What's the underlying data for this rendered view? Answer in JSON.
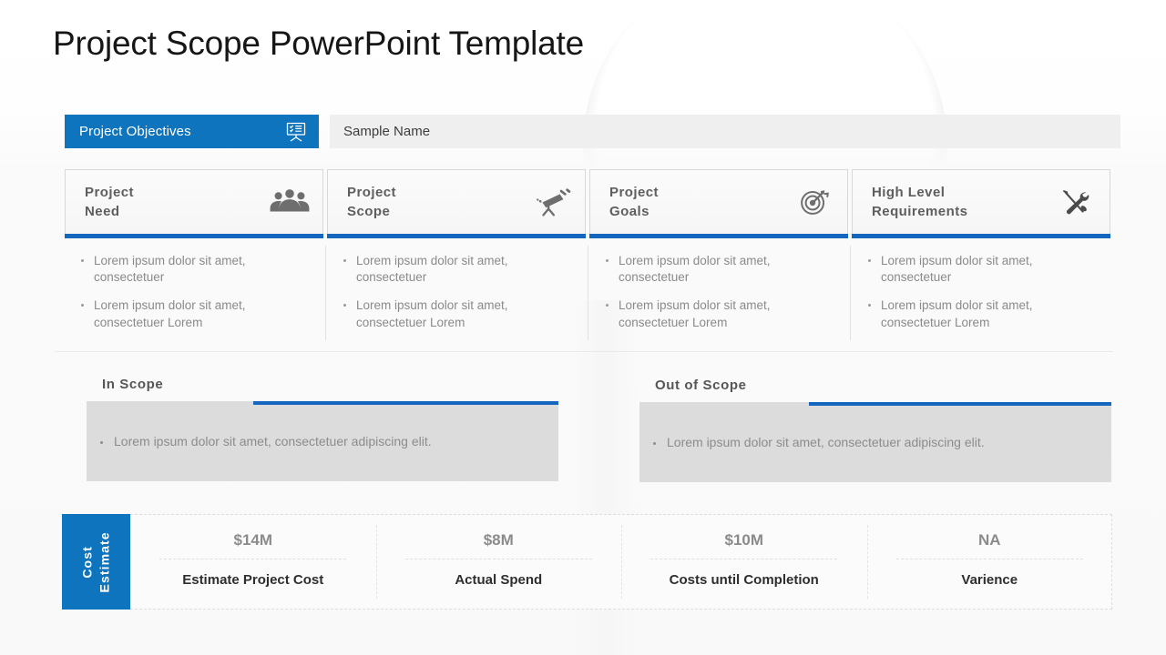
{
  "page_title": "Project Scope PowerPoint Template",
  "header": {
    "objectives_label": "Project Objectives",
    "objectives_icon": "presentation-board-icon",
    "sample_name_value": "Sample Name",
    "accent_color": "#0e74bd"
  },
  "cards": [
    {
      "title": "Project\nNeed",
      "icon": "people-group-icon",
      "bullets": [
        "Lorem ipsum dolor sit amet, consectetuer",
        "Lorem ipsum dolor sit amet, consectetuer Lorem"
      ]
    },
    {
      "title": "Project\nScope",
      "icon": "telescope-icon",
      "bullets": [
        "Lorem ipsum dolor sit amet, consectetuer",
        "Lorem ipsum dolor sit amet, consectetuer Lorem"
      ]
    },
    {
      "title": "Project\nGoals",
      "icon": "target-dartboard-icon",
      "bullets": [
        "Lorem ipsum dolor sit amet, consectetuer",
        "Lorem ipsum dolor sit amet, consectetuer Lorem"
      ]
    },
    {
      "title": "High Level\nRequirements",
      "icon": "tools-wrench-screwdriver-icon",
      "bullets": [
        "Lorem ipsum dolor sit amet, consectetuer",
        "Lorem ipsum dolor sit amet, consectetuer Lorem"
      ]
    }
  ],
  "scope": {
    "in": {
      "title": "In Scope",
      "text": "Lorem ipsum dolor sit amet, consectetuer  adipiscing elit."
    },
    "out": {
      "title": "Out of Scope",
      "text": "Lorem ipsum dolor sit amet, consectetuer  adipiscing elit."
    }
  },
  "cost_estimate": {
    "badge_label": "Cost\nEstimate",
    "cells": [
      {
        "amount": "$14M",
        "label": "Estimate Project Cost"
      },
      {
        "amount": "$8M",
        "label": "Actual Spend"
      },
      {
        "amount": "$10M",
        "label": "Costs until Completion"
      },
      {
        "amount": "NA",
        "label": "Varience"
      }
    ]
  },
  "colors": {
    "brand_blue": "#0e74bd",
    "accent_bar_blue": "#1566bf",
    "scope_box_gray": "#dcdcdc",
    "sample_bar_gray": "#efefef"
  }
}
